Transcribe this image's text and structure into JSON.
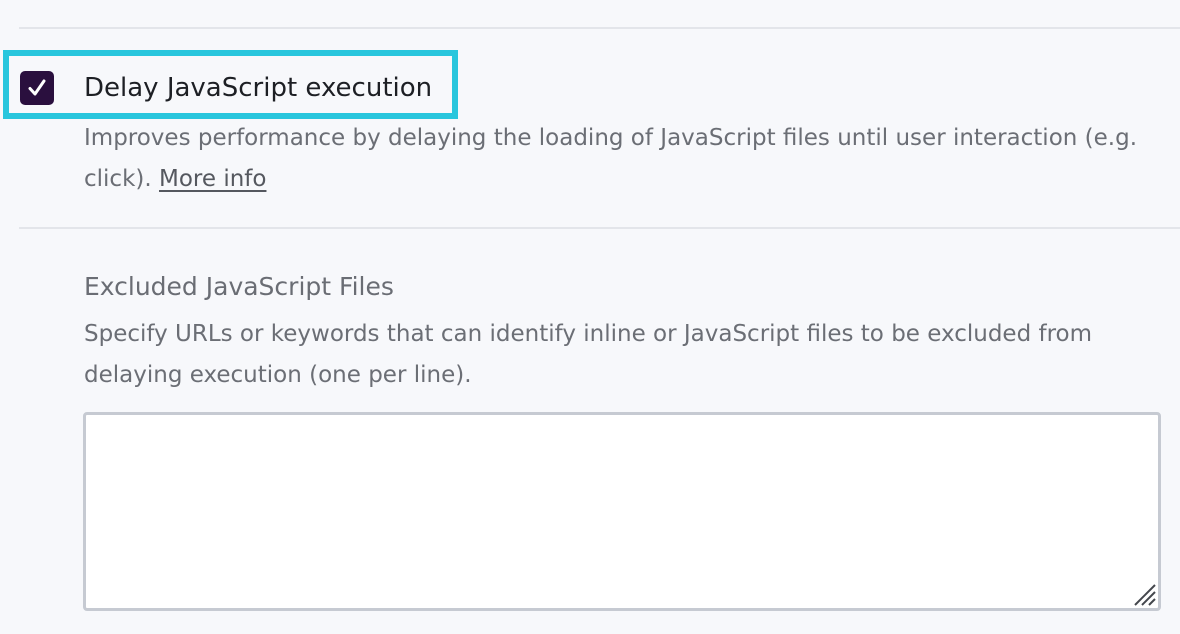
{
  "option": {
    "label": "Delay JavaScript execution",
    "checked": true,
    "description": "Improves performance by delaying the loading of JavaScript files until user interaction (e.g. click).",
    "more_info_label": "More info",
    "check_icon": "check-icon",
    "checkbox_color": "#2a0f3e",
    "highlight_color": "#29c6dd"
  },
  "excluded": {
    "title": "Excluded JavaScript Files",
    "description": "Specify URLs or keywords that can identify inline or JavaScript files to be excluded from delaying execution (one per line).",
    "value": "",
    "resize_icon": "resize-grip-icon"
  }
}
